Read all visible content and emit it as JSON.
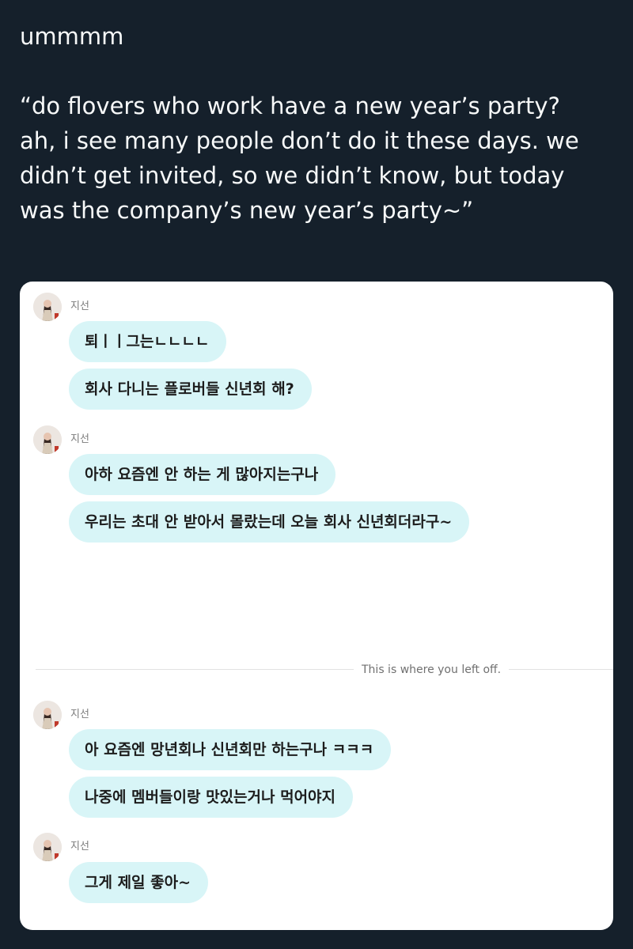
{
  "tweet": {
    "line1": "ummmm",
    "quote_lines": [
      "“do flovers who work have a new year’s party?",
      "ah, i see many people don’t do it these days. we",
      "didn’t get invited, so we didn’t know, but today",
      "was the company’s new year’s party~”"
    ]
  },
  "chat": {
    "groups": [
      {
        "sender": "지선",
        "messages": [
          "퇴ㅣㅣ그는ㄴㄴㄴㄴ",
          "회사 다니는 플로버들 신년회 해?"
        ]
      },
      {
        "sender": "지선",
        "messages": [
          "아하 요즘엔 안 하는 게 많아지는구나",
          "우리는 초대 안 받아서 몰랐는데 오늘 회사 신년회더라구~"
        ]
      },
      {
        "sender": "지선",
        "messages": [
          "아 요즘엔 망년회나 신년회만 하는구나 ㅋㅋㅋ",
          "나중에 멤버들이랑 맛있는거나 먹어야지"
        ]
      },
      {
        "sender": "지선",
        "messages": [
          "그게 제일 좋아~"
        ]
      }
    ],
    "divider_label": "This is where you left off."
  },
  "colors": {
    "background": "#15202b",
    "bubble": "#d8f5f7",
    "card": "#ffffff"
  }
}
